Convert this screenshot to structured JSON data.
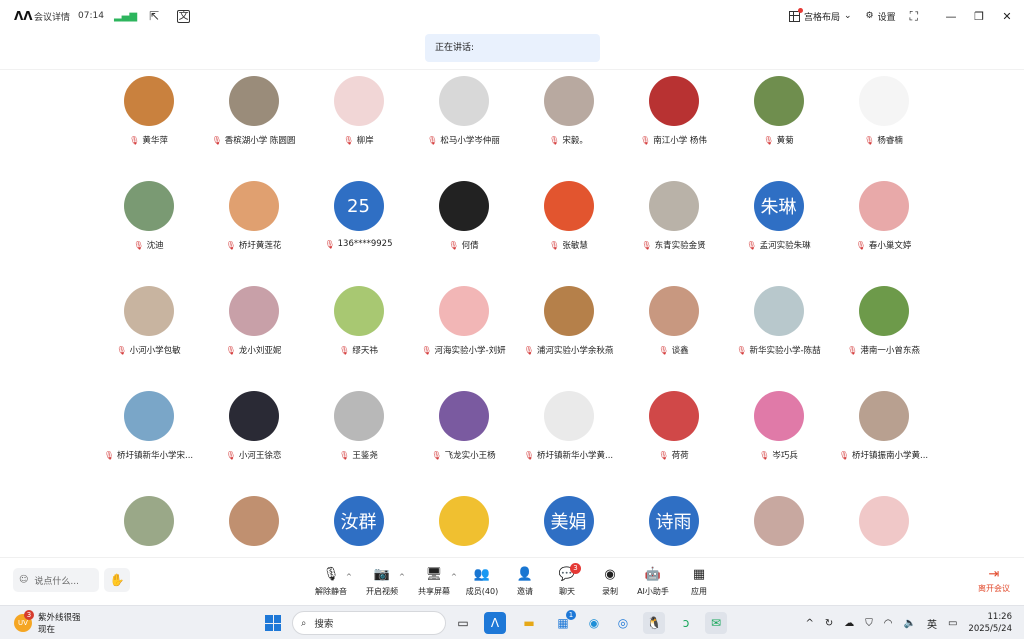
{
  "topbar": {
    "title": "会议详情",
    "time": "07:14",
    "layout_label": "宫格布局",
    "settings_label": "设置"
  },
  "speaking": {
    "label": "正在讲话:"
  },
  "participants": [
    {
      "name": "黄华萍",
      "color": "#c9813e"
    },
    {
      "name": "香槟湖小学 陈圆圆",
      "color": "#9a8c7a"
    },
    {
      "name": "柳岸",
      "color": "#f1d6d6"
    },
    {
      "name": "松马小学岑仲丽",
      "color": "#d8d8d8"
    },
    {
      "name": "宋毅。",
      "color": "#b8a9a0"
    },
    {
      "name": "南江小学 杨伟",
      "color": "#b83232"
    },
    {
      "name": "黄菊",
      "color": "#6f8e4e"
    },
    {
      "name": "杨睿楠",
      "color": "#f5f5f5"
    },
    {
      "name": "沈迪",
      "color": "#7a9a73"
    },
    {
      "name": "桥圩黄莲花",
      "color": "#e0a070"
    },
    {
      "name": "136****9925",
      "color": "#2f6fc4",
      "text": "25"
    },
    {
      "name": "何倩",
      "color": "#222222"
    },
    {
      "name": "张敏慧",
      "color": "#e2552f"
    },
    {
      "name": "东青实验金贤",
      "color": "#b9b2a8"
    },
    {
      "name": "孟河实验朱琳",
      "color": "#2f6fc4",
      "text": "朱琳"
    },
    {
      "name": "春小巢文婷",
      "color": "#e8a9a9"
    },
    {
      "name": "小河小学包敏",
      "color": "#c8b4a0"
    },
    {
      "name": "龙小刘亚妮",
      "color": "#c8a0a8"
    },
    {
      "name": "缪天祎",
      "color": "#a8c872"
    },
    {
      "name": "河海实验小学-刘妍",
      "color": "#f2b6b6"
    },
    {
      "name": "浦河实验小学余秋燕",
      "color": "#b5804a"
    },
    {
      "name": "谈鑫",
      "color": "#c89880"
    },
    {
      "name": "新华实验小学-陈喆",
      "color": "#b8c8cc"
    },
    {
      "name": "港南一小曾东燕",
      "color": "#6d9a4a"
    },
    {
      "name": "桥圩镇新华小学宋...",
      "color": "#7aa6c8"
    },
    {
      "name": "小河王徐恋",
      "color": "#2a2a35"
    },
    {
      "name": "王鉴尧",
      "color": "#b8b8b8"
    },
    {
      "name": "飞龙实小王杨",
      "color": "#7a5aa0"
    },
    {
      "name": "桥圩镇新华小学黄...",
      "color": "#eaeaea"
    },
    {
      "name": "荷荷",
      "color": "#d04848"
    },
    {
      "name": "岑巧兵",
      "color": "#e07aa8"
    },
    {
      "name": "桥圩镇振南小学黄...",
      "color": "#b8a090"
    },
    {
      "name": "",
      "color": "#9aa888"
    },
    {
      "name": "",
      "color": "#c09070"
    },
    {
      "name": "",
      "color": "#2f6fc4",
      "text": "汝群"
    },
    {
      "name": "",
      "color": "#f0c030"
    },
    {
      "name": "",
      "color": "#2f6fc4",
      "text": "美娟"
    },
    {
      "name": "",
      "color": "#2f6fc4",
      "text": "诗雨"
    },
    {
      "name": "",
      "color": "#c8a8a0"
    },
    {
      "name": "",
      "color": "#f0c8c8"
    }
  ],
  "bottombar": {
    "chat_placeholder": "说点什么...",
    "controls": [
      {
        "label": "解除静音",
        "icon": "mic-off"
      },
      {
        "label": "开启视频",
        "icon": "camera-off"
      },
      {
        "label": "共享屏幕",
        "icon": "share-screen"
      },
      {
        "label": "成员(40)",
        "icon": "members"
      },
      {
        "label": "邀请",
        "icon": "invite"
      },
      {
        "label": "聊天",
        "icon": "chat",
        "badge": "3"
      },
      {
        "label": "录制",
        "icon": "record"
      },
      {
        "label": "AI小助手",
        "icon": "ai-assistant"
      },
      {
        "label": "应用",
        "icon": "apps"
      }
    ],
    "leave_label": "离开会议"
  },
  "taskbar": {
    "weather_title": "紫外线很强",
    "weather_sub": "现在",
    "weather_badge": "3",
    "search_placeholder": "搜索",
    "store_badge": "1",
    "ime": "英",
    "clock_time": "11:26",
    "clock_date": "2025/5/24"
  }
}
